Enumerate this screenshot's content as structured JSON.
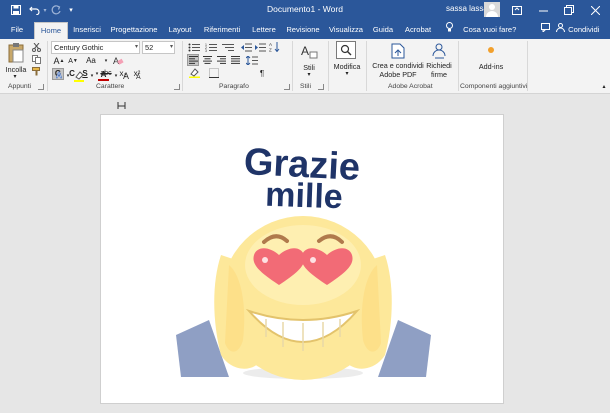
{
  "titlebar": {
    "title": "Documento1  -  Word",
    "user_name": "sassa lassa",
    "quick_access": [
      "save-icon",
      "undo-icon",
      "redo-icon",
      "customize-icon"
    ],
    "window_buttons": [
      "ribbon-display-icon",
      "minimize-icon",
      "restore-icon",
      "close-icon"
    ],
    "color": "#2b579a"
  },
  "tabs": {
    "items": [
      "File",
      "Home",
      "Inserisci",
      "Progettazione",
      "Layout",
      "Riferimenti",
      "Lettere",
      "Revisione",
      "Visualizza",
      "Guida",
      "Acrobat"
    ],
    "active": "Home",
    "tell_me": "Cosa vuoi fare?",
    "share": "Condividi"
  },
  "ribbon": {
    "clipboard": {
      "paste_label": "Incolla",
      "group_label": "Appunti"
    },
    "font": {
      "font_name": "Century Gothic",
      "font_size": "52",
      "group_label": "Carattere",
      "bold": "G",
      "italic": "C",
      "underline": "S",
      "strikethrough": "abc",
      "subscript": "x₂",
      "superscript": "x²",
      "grow": "A",
      "shrink": "A",
      "case": "Aa",
      "text_effects": "A",
      "highlight": "ab",
      "font_color": "A",
      "font_color_value": "#c00000",
      "highlight_color_value": "#ffff00"
    },
    "paragraph": {
      "group_label": "Paragrafo",
      "pilcrow": "¶"
    },
    "styles": {
      "label": "Stili",
      "group_label": "Stili"
    },
    "editing": {
      "label": "Modifica"
    },
    "acrobat": {
      "create_label_1": "Crea e condividi",
      "create_label_2": "Adobe PDF",
      "request_label_1": "Richiedi",
      "request_label_2": "firme",
      "group_label": "Adobe Acrobat"
    },
    "addins": {
      "label": "Add-ins",
      "group_label": "Componenti aggiuntivi"
    }
  },
  "document": {
    "text_line_1": "Grazie",
    "text_line_2": "mille",
    "text_color": "#1f3468",
    "emoji_color": "#fde89a",
    "heart_color": "#f26b76",
    "sleeve_color": "#8f9fc4"
  }
}
